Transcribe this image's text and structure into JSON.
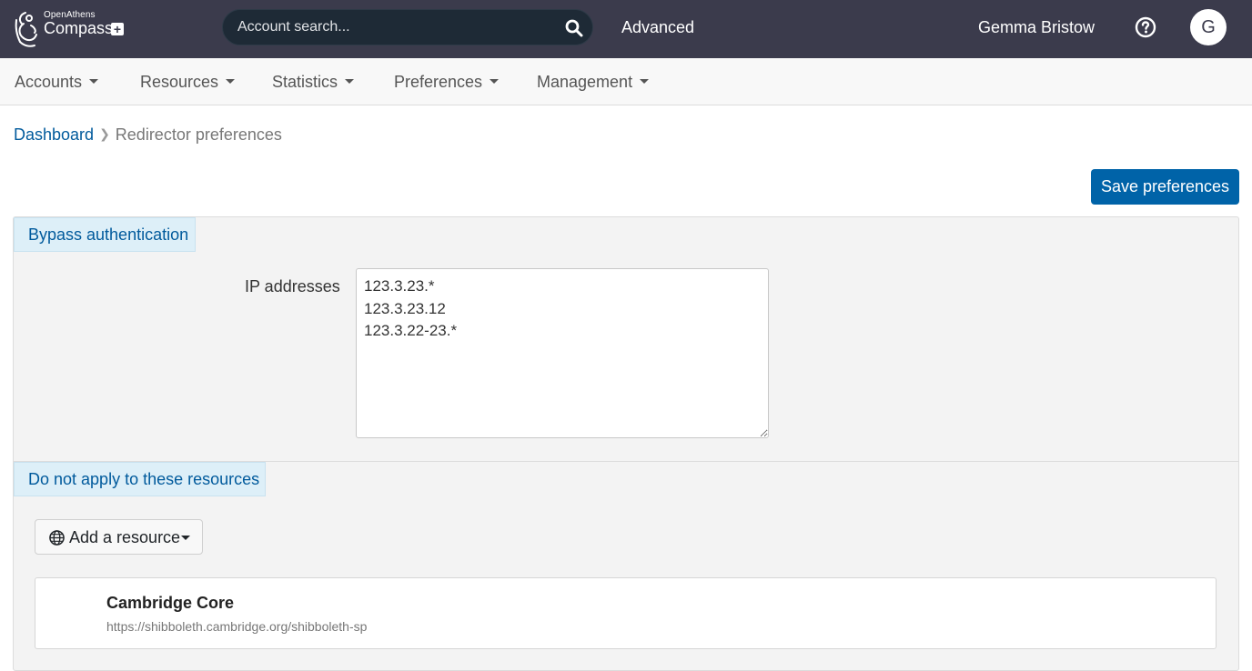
{
  "app": {
    "logo_small": "OpenAthens",
    "logo_big": "Compass",
    "logo_plus": "+"
  },
  "header": {
    "search_placeholder": "Account search...",
    "advanced_label": "Advanced",
    "user_name": "Gemma Bristow",
    "avatar_initial": "G"
  },
  "nav": {
    "items": [
      {
        "label": "Accounts"
      },
      {
        "label": "Resources"
      },
      {
        "label": "Statistics"
      },
      {
        "label": "Preferences"
      },
      {
        "label": "Management"
      }
    ]
  },
  "breadcrumb": {
    "home": "Dashboard",
    "current": "Redirector preferences"
  },
  "actions": {
    "save_label": "Save preferences"
  },
  "bypass": {
    "section_title": "Bypass authentication",
    "ip_label": "IP addresses",
    "ip_value": "123.3.23.*\n123.3.23.12\n123.3.22-23.*"
  },
  "exclusions": {
    "section_title": "Do not apply to these resources",
    "add_label": "Add a resource",
    "resources": [
      {
        "name": "Cambridge Core",
        "url": "https://shibboleth.cambridge.org/shibboleth-sp"
      }
    ]
  },
  "colors": {
    "topbar": "#3b3b4c",
    "primary": "#0063a8",
    "link": "#005a9c",
    "tab_bg": "#ddeff8"
  }
}
